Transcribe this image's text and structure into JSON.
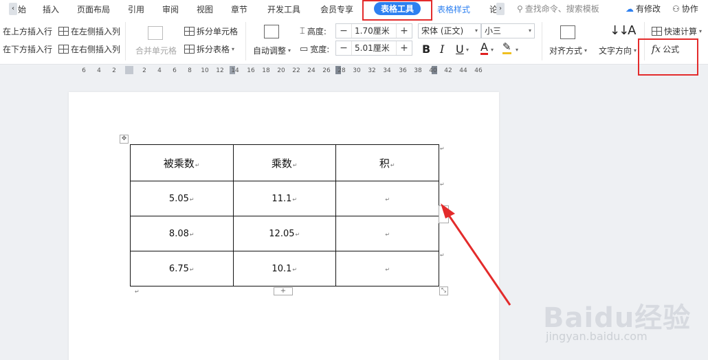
{
  "tabs": {
    "partial_start": "始",
    "items": [
      "插入",
      "页面布局",
      "引用",
      "审阅",
      "视图",
      "章节",
      "开发工具",
      "会员专享"
    ],
    "active": "表格工具",
    "table_style": "表格样式",
    "partial_end": "论"
  },
  "right_tools": {
    "search": "查找命令、搜索模板",
    "modified": "有修改",
    "collab": "协作"
  },
  "ribbon": {
    "insert_above": "在上方插入行",
    "insert_below": "在下方插入行",
    "insert_left": "在左侧插入列",
    "insert_right": "在右侧插入列",
    "merge_cells": "合并单元格",
    "split_cells": "拆分单元格",
    "split_table": "拆分表格",
    "auto_fit": "自动调整",
    "height_label": "高度:",
    "height_value": "1.70厘米",
    "width_label": "宽度:",
    "width_value": "5.01厘米",
    "font_name": "宋体 (正文)",
    "font_size": "小三",
    "bold": "B",
    "italic": "I",
    "underline": "U",
    "font_color": "A",
    "align": "对齐方式",
    "text_direction": "文字方向",
    "quick_calc": "快速计算",
    "formula": "公式",
    "formula_fx": "fx"
  },
  "ruler": {
    "labels": [
      "6",
      "4",
      "2",
      "2",
      "4",
      "6",
      "8",
      "10",
      "12",
      "14",
      "16",
      "18",
      "20",
      "22",
      "24",
      "26",
      "28",
      "30",
      "32",
      "34",
      "36",
      "38",
      "40",
      "42",
      "44",
      "46"
    ]
  },
  "table": {
    "header": [
      "被乘数",
      "乘数",
      "积"
    ],
    "rows": [
      [
        "5.05",
        "11.1",
        ""
      ],
      [
        "8.08",
        "12.05",
        ""
      ],
      [
        "6.75",
        "10.1",
        ""
      ]
    ],
    "para_mark": "↵",
    "add_row": "+"
  },
  "watermark": {
    "logo": "Baidu经验",
    "sub": "jingyan.baidu.com"
  },
  "colors": {
    "accent": "#2e80f0",
    "annotation_red": "#e32b2b"
  }
}
